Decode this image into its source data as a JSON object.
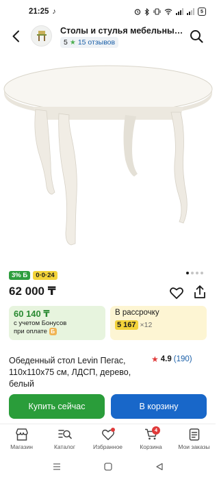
{
  "status_bar": {
    "time": "21:25",
    "battery": "5"
  },
  "header": {
    "store_title": "Столы и стулья мебельный…",
    "rating": "5",
    "reviews": "15 отзывов"
  },
  "gallery": {
    "image_alt_name": "white-round-table-photo",
    "slides_total": 4,
    "active_slide": 1
  },
  "badges": {
    "cashback": "3% Б",
    "installment": "0·0·24"
  },
  "price": "62 000 ₸",
  "bonus_card": {
    "amount": "60 140 ₸",
    "line1": "с учетом Бонусов",
    "line2": "при оплате"
  },
  "installment_card": {
    "label": "В рассрочку",
    "monthly": "5 167",
    "term": "×12"
  },
  "product": {
    "name": "Обеденный стол Levin Пегас, 110х110х75 см, ЛДСП, дерево, белый",
    "rating": "4.9",
    "reviews": "(190)"
  },
  "actions": {
    "buy_now": "Купить сейчас",
    "add_to_cart": "В корзину"
  },
  "bottom_nav": {
    "items": [
      {
        "label": "Магазин"
      },
      {
        "label": "Каталог"
      },
      {
        "label": "Избранное"
      },
      {
        "label": "Корзина"
      },
      {
        "label": "Мои заказы"
      }
    ],
    "cart_count": "4"
  },
  "colors": {
    "green": "#2a9d3a",
    "blue": "#1867c9",
    "yellow": "#f3d33a",
    "red": "#e03a3a"
  }
}
